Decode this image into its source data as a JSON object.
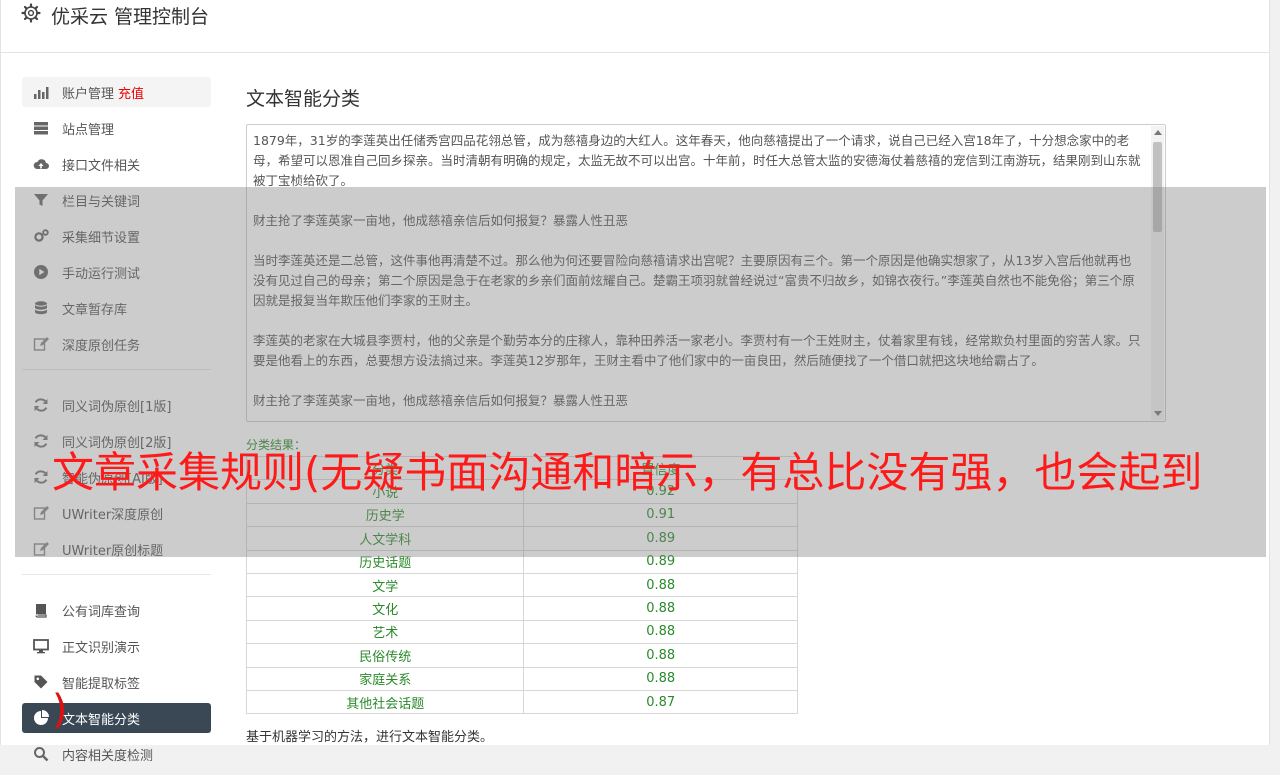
{
  "header": {
    "title": "优采云 管理控制台",
    "icon": "gear-icon"
  },
  "sidebar": {
    "groups": [
      [
        {
          "label": "账户管理",
          "extra": "充值",
          "icon": "bar-chart-icon",
          "state": "light"
        },
        {
          "label": "站点管理",
          "icon": "server-icon"
        },
        {
          "label": "接口文件相关",
          "icon": "cloud-upload-icon"
        },
        {
          "label": "栏目与关键词",
          "icon": "filter-icon"
        },
        {
          "label": "采集细节设置",
          "icon": "cogs-icon"
        },
        {
          "label": "手动运行测试",
          "icon": "play-circle-icon"
        },
        {
          "label": "文章暂存库",
          "icon": "database-icon"
        },
        {
          "label": "深度原创任务",
          "icon": "edit-icon"
        }
      ],
      [
        {
          "label": "同义词伪原创[1版]",
          "icon": "refresh-icon"
        },
        {
          "label": "同义词伪原创[2版]",
          "icon": "refresh-icon"
        },
        {
          "label": "智能伪原创[AI版]",
          "icon": "refresh-icon"
        },
        {
          "label": "UWriter深度原创",
          "icon": "edit-icon"
        },
        {
          "label": "UWriter原创标题",
          "icon": "edit-icon"
        }
      ],
      [
        {
          "label": "公有词库查询",
          "icon": "book-icon"
        },
        {
          "label": "正文识别演示",
          "icon": "monitor-icon"
        },
        {
          "label": "智能提取标签",
          "icon": "tag-icon"
        },
        {
          "label": "文本智能分类",
          "icon": "pie-chart-icon",
          "state": "active"
        },
        {
          "label": "内容相关度检测",
          "icon": "search-icon"
        }
      ]
    ]
  },
  "main": {
    "title": "文本智能分类",
    "text": "1879年，31岁的李莲英出任储秀宫四品花翎总管，成为慈禧身边的大红人。这年春天，他向慈禧提出了一个请求，说自己已经入宫18年了，十分想念家中的老母，希望可以恩准自己回乡探亲。当时清朝有明确的规定，太监无故不可以出宫。十年前，时任大总管太监的安德海仗着慈禧的宠信到江南游玩，结果刚到山东就被丁宝桢给砍了。\n\n财主抢了李莲英家一亩地，他成慈禧亲信后如何报复？暴露人性丑恶\n\n当时李莲英还是二总管，这件事他再清楚不过。那么他为何还要冒险向慈禧请求出宫呢？主要原因有三个。第一个原因是他确实想家了，从13岁入宫后他就再也没有见过自己的母亲；第二个原因是急于在老家的乡亲们面前炫耀自己。楚霸王项羽就曾经说过“富贵不归故乡，如锦衣夜行。”李莲英自然也不能免俗；第三个原因就是报复当年欺压他们李家的王财主。\n\n李莲英的老家在大城县李贾村，他的父亲是个勤劳本分的庄稼人，靠种田养活一家老小。李贾村有一个王姓财主，仗着家里有钱，经常欺负村里面的穷苦人家。只要是他看上的东西，总要想方设法搞过来。李莲英12岁那年，王财主看中了他们家中的一亩良田，然后随便找了一个借口就把这块地给霸占了。\n\n财主抢了李莲英家一亩地，他成慈禧亲信后如何报复？暴露人性丑恶",
    "result_label": "分类结果：",
    "table": {
      "headers": [
        "分类",
        "置信度"
      ],
      "rows": [
        [
          "小说",
          "0.92"
        ],
        [
          "历史学",
          "0.91"
        ],
        [
          "人文学科",
          "0.89"
        ],
        [
          "历史话题",
          "0.89"
        ],
        [
          "文学",
          "0.88"
        ],
        [
          "文化",
          "0.88"
        ],
        [
          "艺术",
          "0.88"
        ],
        [
          "民俗传统",
          "0.88"
        ],
        [
          "家庭关系",
          "0.88"
        ],
        [
          "其他社会话题",
          "0.87"
        ]
      ]
    },
    "footnote": "基于机器学习的方法，进行文本智能分类。"
  },
  "banner": {
    "text": "文章采集规则(无疑书面沟通和暗示，有总比没有强，也会起到",
    "corner": ")"
  },
  "colors": {
    "active_bg": "#3a4856",
    "result_green": "#2b8a2b",
    "recharge_red": "#ee0000",
    "banner_red": "#ff1a1a"
  }
}
